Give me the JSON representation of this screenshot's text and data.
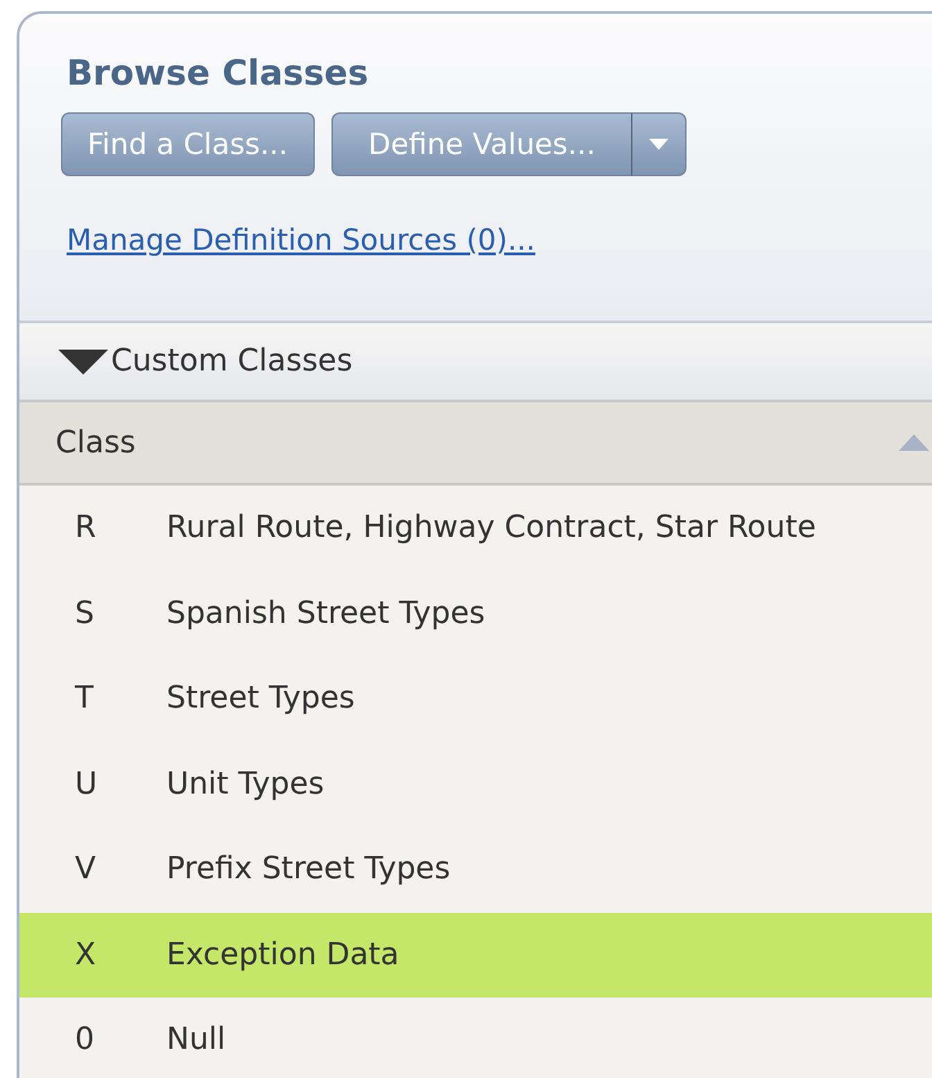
{
  "panel": {
    "title": "Browse Classes"
  },
  "buttons": [
    {
      "label": "Find a Class...",
      "kind": "plain"
    },
    {
      "label": "Define Values...",
      "kind": "split"
    }
  ],
  "link": "Manage Definition Sources (0)...",
  "section": {
    "label": "Custom Classes",
    "expanded": true
  },
  "table": {
    "columns": [
      "Class"
    ],
    "rows": [
      {
        "code": "R",
        "name": "Rural Route, Highway Contract, Star Route",
        "selected": false
      },
      {
        "code": "S",
        "name": "Spanish Street Types",
        "selected": false
      },
      {
        "code": "T",
        "name": "Street Types",
        "selected": false
      },
      {
        "code": "U",
        "name": "Unit Types",
        "selected": false
      },
      {
        "code": "V",
        "name": "Prefix Street Types",
        "selected": false
      },
      {
        "code": "X",
        "name": "Exception Data",
        "selected": true
      },
      {
        "code": "0",
        "name": "Null",
        "selected": false
      }
    ]
  }
}
